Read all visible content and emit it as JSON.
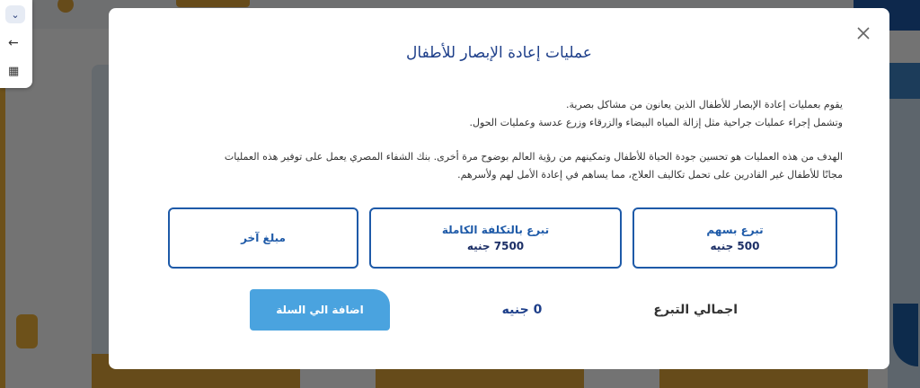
{
  "modal": {
    "title": "عمليات إعادة الإبصار للأطفال",
    "description_line1": "يقوم بعمليات إعادة الإبصار للأطفال الذين يعانون من مشاكل بصرية.",
    "description_line2": "وتشمل إجراء عمليات جراحية مثل إزالة المياه البيضاء والزرقاء وزرع عدسة وعمليات الحول.",
    "goal_line1": "الهدف من هذه العمليات هو تحسين جودة الحياة للأطفال وتمكينهم من رؤية العالم بوضوح مرة أخرى. بنك الشفاء المصري يعمل على توفير هذه العمليات",
    "goal_line2": "مجانًا للأطفال غير القادرين على تحمل تكاليف العلاج، مما يساهم في إعادة الأمل لهم ولأسرهم.",
    "options": [
      {
        "label": "تبرع بسهم",
        "value": "500 جنيه"
      },
      {
        "label": "تبرع بالتكلفة الكاملة",
        "value": "7500 جنيه"
      },
      {
        "label": "مبلغ آخر",
        "value": ""
      }
    ],
    "total_label": "اجمالي التبرع",
    "total_value": "0 جنيه",
    "add_to_cart_label": "اضافة الي السلة"
  },
  "icons": {
    "close": "close-icon",
    "chevron": "chevron-down-icon",
    "back": "arrow-left-icon",
    "grid": "grid-icon"
  },
  "colors": {
    "primary": "#1e5aa8",
    "title": "#1e3f8a",
    "button": "#4aa3df",
    "accent": "#e3a63a"
  }
}
